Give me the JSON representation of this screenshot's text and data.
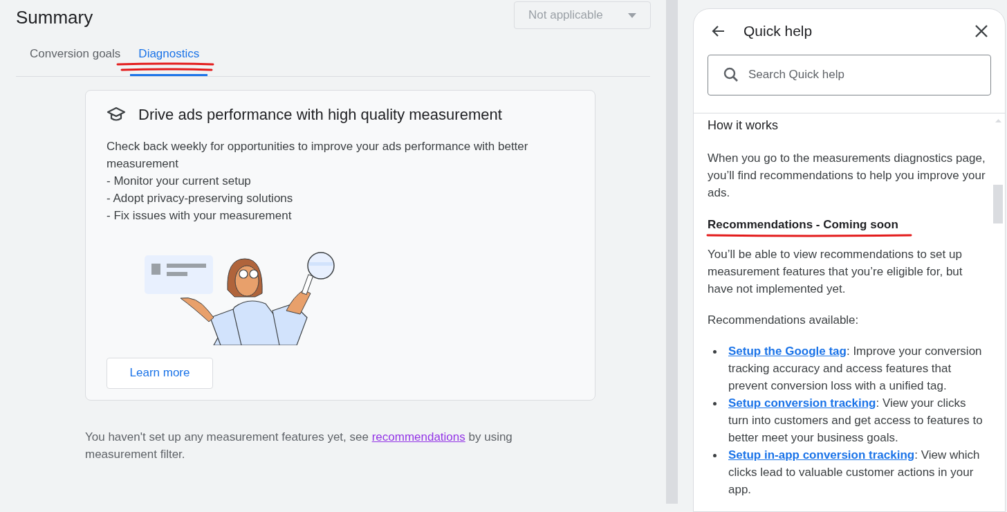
{
  "summary": {
    "title": "Summary",
    "dropdown": {
      "value": "Not applicable",
      "disabled": true
    }
  },
  "tabs": [
    {
      "label": "Conversion goals",
      "selected": false
    },
    {
      "label": "Diagnostics",
      "selected": true
    }
  ],
  "card": {
    "title": "Drive ads performance with high quality measurement",
    "lines": [
      "Check back weekly for opportunities to improve your ads performance with better measurement",
      "- Monitor your current setup",
      "- Adopt privacy-preserving solutions",
      "- Fix issues with your measurement"
    ],
    "button": "Learn more"
  },
  "footer_note": {
    "before": "You haven't set up any measurement features yet, see ",
    "link": "recommendations",
    "after": " by using measurement filter."
  },
  "quick_help": {
    "title": "Quick help",
    "search": {
      "placeholder": "Search Quick help"
    },
    "heading": "How it works",
    "intro": "When you go to the measurements diagnostics page, you’ll find recommendations to help you improve your ads.",
    "subheading": "Recommendations - Coming soon",
    "subtext": "You’ll be able to view recommendations to set up measurement features that you’re eligible for, but have not implemented yet.",
    "list_title": "Recommendations available:",
    "items": [
      {
        "link": "Setup the Google tag",
        "text": ": Improve your conversion tracking accuracy and access features that prevent conversion loss with a unified tag."
      },
      {
        "link": "Setup conversion tracking",
        "text": ": View your clicks turn into customers and get access to features to better meet your business goals."
      },
      {
        "link": "Setup in-app conversion tracking",
        "text": ": View which clicks lead to valuable customer actions in your app."
      }
    ]
  }
}
